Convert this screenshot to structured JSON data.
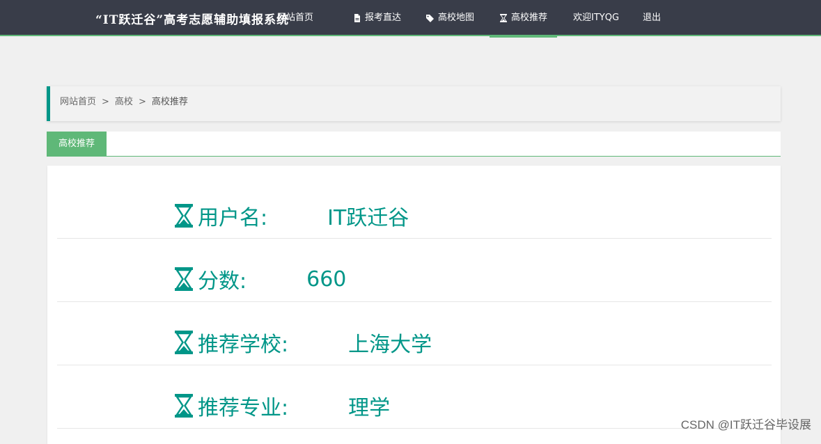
{
  "header": {
    "brand": "“IT跃迁谷”高考志愿辅助填报系统",
    "nav": [
      {
        "label": "网站首页",
        "icon": "home-icon"
      },
      {
        "label": "报考直达",
        "icon": "file-icon"
      },
      {
        "label": "高校地图",
        "icon": "tags-icon"
      },
      {
        "label": "高校推荐",
        "icon": "hourglass-icon",
        "active": true
      },
      {
        "label": "欢迎ITYQG"
      },
      {
        "label": "退出"
      }
    ]
  },
  "breadcrumb": [
    "网站首页",
    "高校",
    "高校推荐"
  ],
  "breadcrumb_sep": ">",
  "tab": {
    "label": "高校推荐"
  },
  "info": [
    {
      "label": "用户名:",
      "value": "IT跃迁谷"
    },
    {
      "label": "分数:",
      "value": "660"
    },
    {
      "label": "推荐学校:",
      "value": "上海大学"
    },
    {
      "label": "推荐专业:",
      "value": "理学"
    }
  ],
  "watermark": "CSDN @IT跃迁谷毕设展",
  "colors": {
    "nav_bg": "#393d49",
    "accent": "#5fb878",
    "teal": "#009688"
  }
}
